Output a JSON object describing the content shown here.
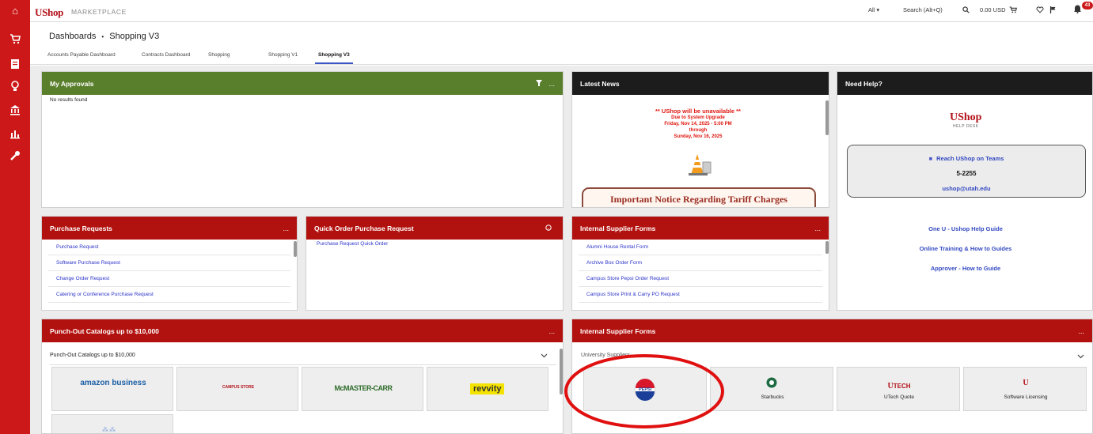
{
  "topbar": {
    "brand": "UShop",
    "brand_sub": "MARKETPLACE",
    "scope": "All ▾",
    "search_placeholder": "Search (Alt+Q)",
    "cart_total": "0.00 USD",
    "notification_count": "43"
  },
  "header": {
    "breadcrumb_root": "Dashboards",
    "breadcrumb_sep": "•",
    "breadcrumb_current": "Shopping V3"
  },
  "tabs": [
    {
      "label": "Accounts Payable Dashboard"
    },
    {
      "label": "Contracts Dashboard"
    },
    {
      "label": "Shopping"
    },
    {
      "label": "Shopping V1"
    },
    {
      "label": "Shopping V3"
    }
  ],
  "approvals": {
    "title": "My Approvals",
    "more": "...",
    "empty": "No results found"
  },
  "news": {
    "title": "Latest News",
    "line1": "** UShop will be unavailable **",
    "line2": "Due to System Upgrade",
    "line3": "Friday, Nov 14, 2025 - 5:00 PM",
    "line4": "through",
    "line5": "Sunday, Nov 16, 2025",
    "notice": "Important Notice Regarding Tariff Charges"
  },
  "help": {
    "title": "Need Help?",
    "logo_main": "UShop",
    "logo_sub": "HELP DESK",
    "teams": "Reach UShop on Teams",
    "phone": "5-2255",
    "email": "ushop@utah.edu",
    "links": [
      "One U - Ushop Help Guide",
      "Online Training & How to Guides",
      "Approver - How to Guide"
    ]
  },
  "purchase_requests": {
    "title": "Purchase Requests",
    "more": "...",
    "items": [
      "Purchase Request",
      "Software Purchase Request",
      "Change Order Request",
      "Catering or Conference Purchase Request"
    ]
  },
  "quick_order": {
    "title": "Quick Order Purchase Request",
    "items": [
      "Purchase Request Quick Order"
    ]
  },
  "internal_forms": {
    "title": "Internal Supplier Forms",
    "more": "...",
    "items": [
      "Alumni House Rental Form",
      "Archive Box Order Form",
      "Campus Store Pepsi Order Request",
      "Campus Store Print & Carry PO Request"
    ]
  },
  "punchout": {
    "title": "Punch-Out Catalogs up to $10,000",
    "more": "...",
    "section": "Punch-Out Catalogs up to $10,000",
    "tiles": [
      "amazon business",
      "CAMPUS STORE",
      "McMASTER-CARR",
      "revvity"
    ]
  },
  "suppliers": {
    "title": "Internal Supplier Forms",
    "more": "...",
    "section": "University Suppliers",
    "pepsi_logo": "PEPSI",
    "starbucks": "Starbucks",
    "utech_logo": "TECH",
    "utech": "UTech Quote",
    "software": "Software Licensing"
  },
  "colors": {
    "brand_red": "#cc1818",
    "header_red": "#b2120f",
    "approvals_green": "#5a7f2c",
    "news_black": "#1c1c1c",
    "link_blue": "#2c35c8",
    "annotation_circle": "#e01010"
  }
}
